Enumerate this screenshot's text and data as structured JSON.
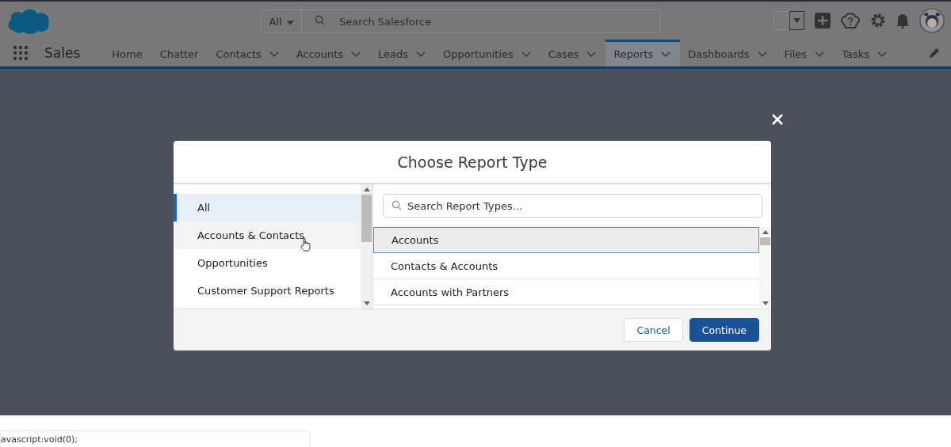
{
  "header": {
    "search_scope": "All",
    "search": {
      "placeholder": "Search Salesforce"
    }
  },
  "nav": {
    "app_name": "Sales",
    "tabs": [
      {
        "label": "Home",
        "selected": false,
        "has_menu": false
      },
      {
        "label": "Chatter",
        "selected": false,
        "has_menu": false
      },
      {
        "label": "Contacts",
        "selected": false,
        "has_menu": true
      },
      {
        "label": "Accounts",
        "selected": false,
        "has_menu": true
      },
      {
        "label": "Leads",
        "selected": false,
        "has_menu": true
      },
      {
        "label": "Opportunities",
        "selected": false,
        "has_menu": true
      },
      {
        "label": "Cases",
        "selected": false,
        "has_menu": true
      },
      {
        "label": "Reports",
        "selected": true,
        "has_menu": true
      },
      {
        "label": "Dashboards",
        "selected": false,
        "has_menu": true
      },
      {
        "label": "Files",
        "selected": false,
        "has_menu": true
      },
      {
        "label": "Tasks",
        "selected": false,
        "has_menu": true
      }
    ]
  },
  "modal": {
    "title": "Choose Report Type",
    "categories": [
      {
        "label": "All",
        "selected": true,
        "hovered": false
      },
      {
        "label": "Accounts & Contacts",
        "selected": false,
        "hovered": true
      },
      {
        "label": "Opportunities",
        "selected": false,
        "hovered": false
      },
      {
        "label": "Customer Support Reports",
        "selected": false,
        "hovered": false
      }
    ],
    "search": {
      "placeholder": "Search Report Types..."
    },
    "report_types": [
      {
        "label": "Accounts",
        "selected": true
      },
      {
        "label": "Contacts & Accounts",
        "selected": false
      },
      {
        "label": "Accounts with Partners",
        "selected": false
      }
    ],
    "buttons": [
      {
        "label": "Cancel",
        "kind": "neutral"
      },
      {
        "label": "Continue",
        "kind": "brand"
      }
    ]
  },
  "status_bar": {
    "url": "avascript:void(0);"
  }
}
